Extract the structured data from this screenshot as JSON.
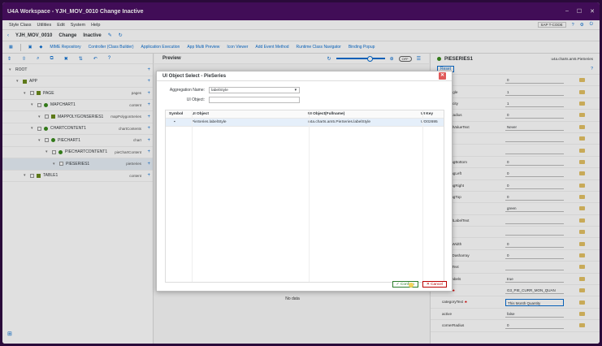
{
  "window": {
    "title": "U4A Workspace - YJH_MOV_0010 Change Inactive",
    "controls": [
      "–",
      "☐",
      "✕"
    ]
  },
  "menu": {
    "items": [
      "Style Class",
      "Utilities",
      "Edit",
      "System",
      "Help"
    ],
    "sap_label": "SAP T-CODE"
  },
  "appbar": {
    "app_id": "YJH_MOV_0010",
    "mode": "Change",
    "state": "Inactive"
  },
  "toolbar": {
    "items": [
      "MIME Repository",
      "Controller (Class Builder)",
      "Application Execution",
      "App Multi Preview",
      "Icon Viewer",
      "Add Event Method",
      "Runtime Class Navigator",
      "Binding Popup"
    ]
  },
  "tree": {
    "rows": [
      {
        "label": "ROOT",
        "agg": "",
        "indent": 0,
        "icon": "none"
      },
      {
        "label": "APP",
        "agg": "",
        "indent": 1,
        "icon": "sq"
      },
      {
        "label": "PAGE",
        "agg": "pages",
        "indent": 2,
        "icon": "sq"
      },
      {
        "label": "MAPCHART1",
        "agg": "content",
        "indent": 3,
        "icon": "dot"
      },
      {
        "label": "MAPPOLYGONSERIES1",
        "agg": "mapPolygonSeries",
        "indent": 4,
        "icon": "sq"
      },
      {
        "label": "CHARTCONTENT1",
        "agg": "chartContents",
        "indent": 3,
        "icon": "dot"
      },
      {
        "label": "PIECHART1",
        "agg": "chart",
        "indent": 4,
        "icon": "dot"
      },
      {
        "label": "PIECHARTCONTENT1",
        "agg": "pieChartContent",
        "indent": 5,
        "icon": "dot"
      },
      {
        "label": "PIESERIES1",
        "agg": "pieSeries",
        "indent": 6,
        "icon": "none"
      },
      {
        "label": "TABLE1",
        "agg": "content",
        "indent": 2,
        "icon": "sq"
      }
    ]
  },
  "preview": {
    "title": "Preview",
    "toggle": "OFF",
    "no_data": "No data"
  },
  "properties": {
    "header": "PIESERIES1",
    "class": "u4a.charts.am5.PieSeries",
    "reset_label": "Reset",
    "rows": [
      {
        "name": "alpha",
        "value": "0",
        "req": false
      },
      {
        "name": "endAngle",
        "value": "1",
        "req": false
      },
      {
        "name": "fillOpacity",
        "value": "1",
        "req": false
      },
      {
        "name": "innerRadius",
        "value": "0",
        "req": false
      },
      {
        "name": "legendValueText",
        "value": "Never",
        "req": false
      },
      {
        "name": "",
        "value": "",
        "req": false
      },
      {
        "name": "",
        "value": "",
        "req": false
      },
      {
        "name": "paddingBottom",
        "value": "0",
        "req": false
      },
      {
        "name": "paddingLeft",
        "value": "0",
        "req": false
      },
      {
        "name": "paddingRight",
        "value": "0",
        "req": false
      },
      {
        "name": "paddingTop",
        "value": "0",
        "req": false
      },
      {
        "name": "fill",
        "value": "green",
        "req": false
      },
      {
        "name": "legendLabelText",
        "value": "",
        "req": false
      },
      {
        "name": "stroke",
        "value": "",
        "req": false
      },
      {
        "name": "strokeWidth",
        "value": "0",
        "req": false
      },
      {
        "name": "strokeDasharray",
        "value": "0",
        "req": false
      },
      {
        "name": "tooltipText",
        "value": "",
        "req": false
      },
      {
        "name": "alignLabels",
        "value": "true",
        "req": false
      },
      {
        "name": "value",
        "value": "G3_PIE_CURR_MON_QUAN",
        "req": true
      },
      {
        "name": "categoryText",
        "value": "This Month Quantity",
        "req": true
      },
      {
        "name": "active",
        "value": "false",
        "req": false
      },
      {
        "name": "cornerRadius",
        "value": "0",
        "req": false
      }
    ]
  },
  "dialog": {
    "title": "UI Object Select - PieSeries",
    "aggregation_label": "Aggregation Name:",
    "aggregation_value": "labelStyle",
    "uiobject_label": "UI Object:",
    "uiobject_value": "",
    "columns": [
      "Symbol",
      "UI Object",
      "UI Object(Fullname)",
      "UI Key"
    ],
    "rows": [
      {
        "symbol": "▪",
        "object": "PieSeries.labelStyle",
        "fullname": "u4a.charts.am5.PieSeries.labelStyle",
        "key": "UO02695"
      }
    ],
    "confirm_label": "Confirm",
    "cancel_label": "Cancel"
  }
}
